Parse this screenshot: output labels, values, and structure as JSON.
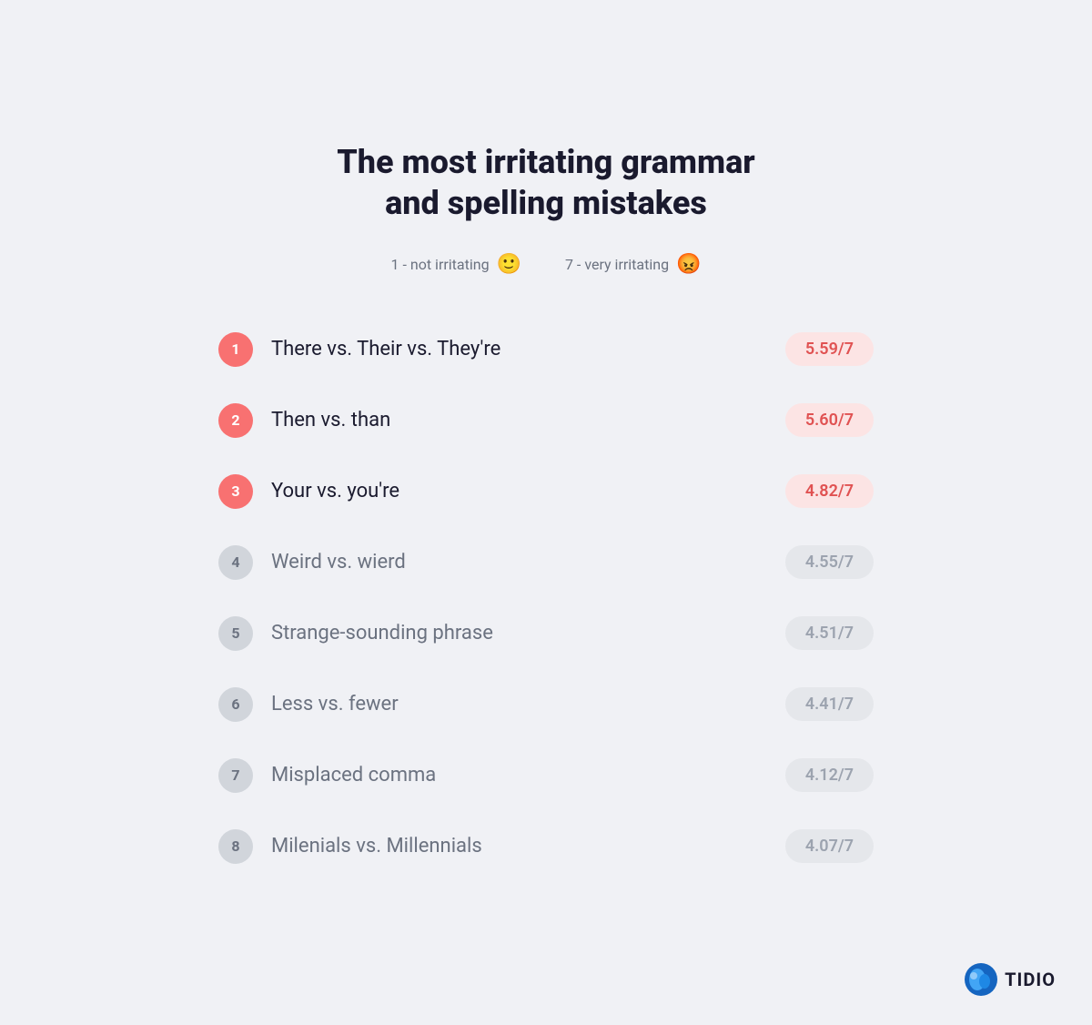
{
  "title": "The most irritating grammar\nand spelling mistakes",
  "legend": {
    "low_label": "1 - not irritating",
    "low_emoji": "🙂",
    "high_label": "7 -  very irritating",
    "high_emoji": "😡"
  },
  "items": [
    {
      "rank": "1",
      "name": "There vs. Their vs. They're",
      "score": "5.59/7",
      "highlight": true
    },
    {
      "rank": "2",
      "name": "Then vs. than",
      "score": "5.60/7",
      "highlight": true
    },
    {
      "rank": "3",
      "name": "Your vs. you're",
      "score": "4.82/7",
      "highlight": true
    },
    {
      "rank": "4",
      "name": "Weird vs. wierd",
      "score": "4.55/7",
      "highlight": false
    },
    {
      "rank": "5",
      "name": "Strange-sounding phrase",
      "score": "4.51/7",
      "highlight": false
    },
    {
      "rank": "6",
      "name": "Less vs. fewer",
      "score": "4.41/7",
      "highlight": false
    },
    {
      "rank": "7",
      "name": "Misplaced comma",
      "score": "4.12/7",
      "highlight": false
    },
    {
      "rank": "8",
      "name": "Milenials vs. Millennials",
      "score": "4.07/7",
      "highlight": false
    }
  ],
  "brand": {
    "name": "TIDIO"
  }
}
